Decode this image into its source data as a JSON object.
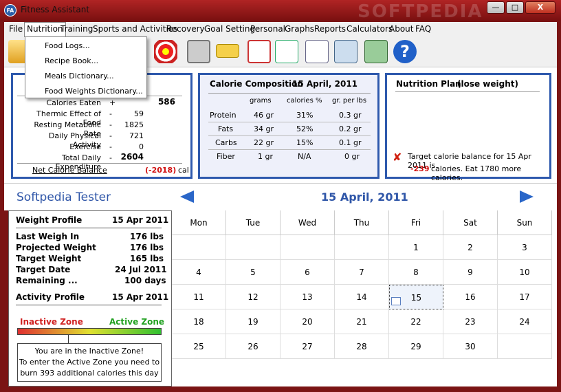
{
  "window": {
    "title": "Fitness Assistant",
    "icon_text": "FA",
    "minimize": "—",
    "maximize": "□",
    "close": "X",
    "watermark": "SOFTPEDIA"
  },
  "menu": [
    "File",
    "Nutrition",
    "Training",
    "Sports and Activities",
    "Recovery",
    "Goal Setting",
    "Personal",
    "Graphs",
    "Reports",
    "Calculators",
    "About",
    "FAQ"
  ],
  "dropdown": [
    "Food Logs...",
    "Recipe Book...",
    "Meals Dictionary...",
    "Food Weights Dictionary..."
  ],
  "toolbar_icons": [
    "food-log-icon",
    "recipe-icon",
    "calories-icon",
    "target-icon",
    "scale-icon",
    "ruler-icon",
    "calendar-icon",
    "graph-icon",
    "report-icon",
    "profile-icon",
    "export-icon",
    "help-icon"
  ],
  "balance": {
    "rows": [
      {
        "label": "Calories Eaten",
        "sign": "+",
        "value": "586"
      },
      {
        "label": "Thermic Effect of Food",
        "sign": "-",
        "value": "59"
      },
      {
        "label": "Resting Metabolic Rate",
        "sign": "-",
        "value": "1825"
      },
      {
        "label": "Daily Physical Activity",
        "sign": "-",
        "value": "721"
      },
      {
        "label": "Exercise",
        "sign": "-",
        "value": "0"
      },
      {
        "label": "Total Daily Expenditure",
        "sign": "-",
        "value": "2604"
      }
    ],
    "net_label": "Net Calorie Balance",
    "net_value": "(-2018)",
    "net_unit": "cal"
  },
  "composition": {
    "title": "Calorie Composition",
    "date": "15 April, 2011",
    "headers": [
      "grams",
      "calories %",
      "gr. per lbs"
    ],
    "rows": [
      {
        "name": "Protein",
        "grams": "46 gr",
        "pct": "31%",
        "perlb": "0.3 gr"
      },
      {
        "name": "Fats",
        "grams": "34 gr",
        "pct": "52%",
        "perlb": "0.2 gr"
      },
      {
        "name": "Carbs",
        "grams": "22 gr",
        "pct": "15%",
        "perlb": "0.1 gr"
      },
      {
        "name": "Fiber",
        "grams": "1 gr",
        "pct": "N/A",
        "perlb": "0 gr"
      }
    ]
  },
  "plan": {
    "title": "Nutrition Plan",
    "mode": "(lose weight)",
    "line1": "Target calorie balance for 15 Apr 2011 is",
    "deficit": "-239",
    "line2": "calories. Eat 1780 more calories."
  },
  "user": "Softpedia Tester",
  "date_heading": "15 April, 2011",
  "weight_profile": {
    "title": "Weight Profile",
    "title_date": "15 Apr 2011",
    "rows": [
      {
        "label": "Last Weigh In",
        "value": "176 lbs"
      },
      {
        "label": "Projected Weight",
        "value": "176 lbs"
      },
      {
        "label": "Target Weight",
        "value": "165 lbs"
      },
      {
        "label": "Target Date",
        "value": "24 Jul 2011"
      },
      {
        "label": "Remaining ...",
        "value": "100 days"
      }
    ],
    "activity_title": "Activity Profile",
    "activity_date": "15 Apr 2011",
    "inactive": "Inactive Zone",
    "active": "Active Zone",
    "msg1": "You are in the Inactive Zone!",
    "msg2": "To enter the Active Zone you need to",
    "msg3": "burn 393 additional calories this day"
  },
  "calendar": {
    "days": [
      "Mon",
      "Tue",
      "Wed",
      "Thu",
      "Fri",
      "Sat",
      "Sun"
    ],
    "weeks": [
      [
        "",
        "",
        "",
        "",
        "1",
        "2",
        "3"
      ],
      [
        "4",
        "5",
        "6",
        "7",
        "8",
        "9",
        "10"
      ],
      [
        "11",
        "12",
        "13",
        "14",
        "15",
        "16",
        "17"
      ],
      [
        "18",
        "19",
        "20",
        "21",
        "22",
        "23",
        "24"
      ],
      [
        "25",
        "26",
        "27",
        "28",
        "29",
        "30",
        ""
      ]
    ],
    "selected": "15"
  }
}
